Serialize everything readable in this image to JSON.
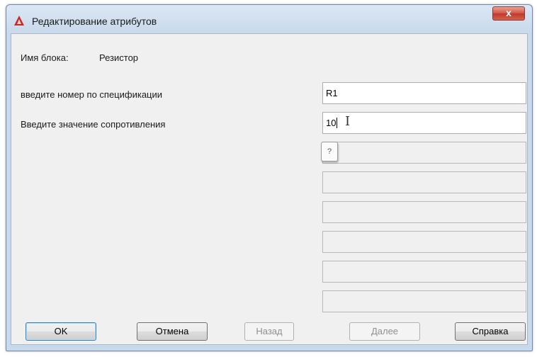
{
  "window": {
    "title": "Редактирование атрибутов",
    "close_label": "x"
  },
  "block": {
    "name_label": "Имя блока:",
    "name_value": "Резистор"
  },
  "attributes": [
    {
      "prompt": "введите номер по спецификации",
      "value": "R1"
    },
    {
      "prompt": "Введите значение сопротивления",
      "value": "10"
    }
  ],
  "tooltip": {
    "text": "?"
  },
  "buttons": {
    "ok": "OK",
    "cancel": "Отмена",
    "back": "Назад",
    "next": "Далее",
    "help": "Справка"
  },
  "colors": {
    "titlebar": "#cfdeee",
    "close_button": "#c0392b",
    "client_bg": "#f0f0f0",
    "app_icon": "#c62828"
  },
  "icons": {
    "app": "autocad-logo-icon",
    "close": "close-icon",
    "cursor": "text-cursor-icon"
  }
}
